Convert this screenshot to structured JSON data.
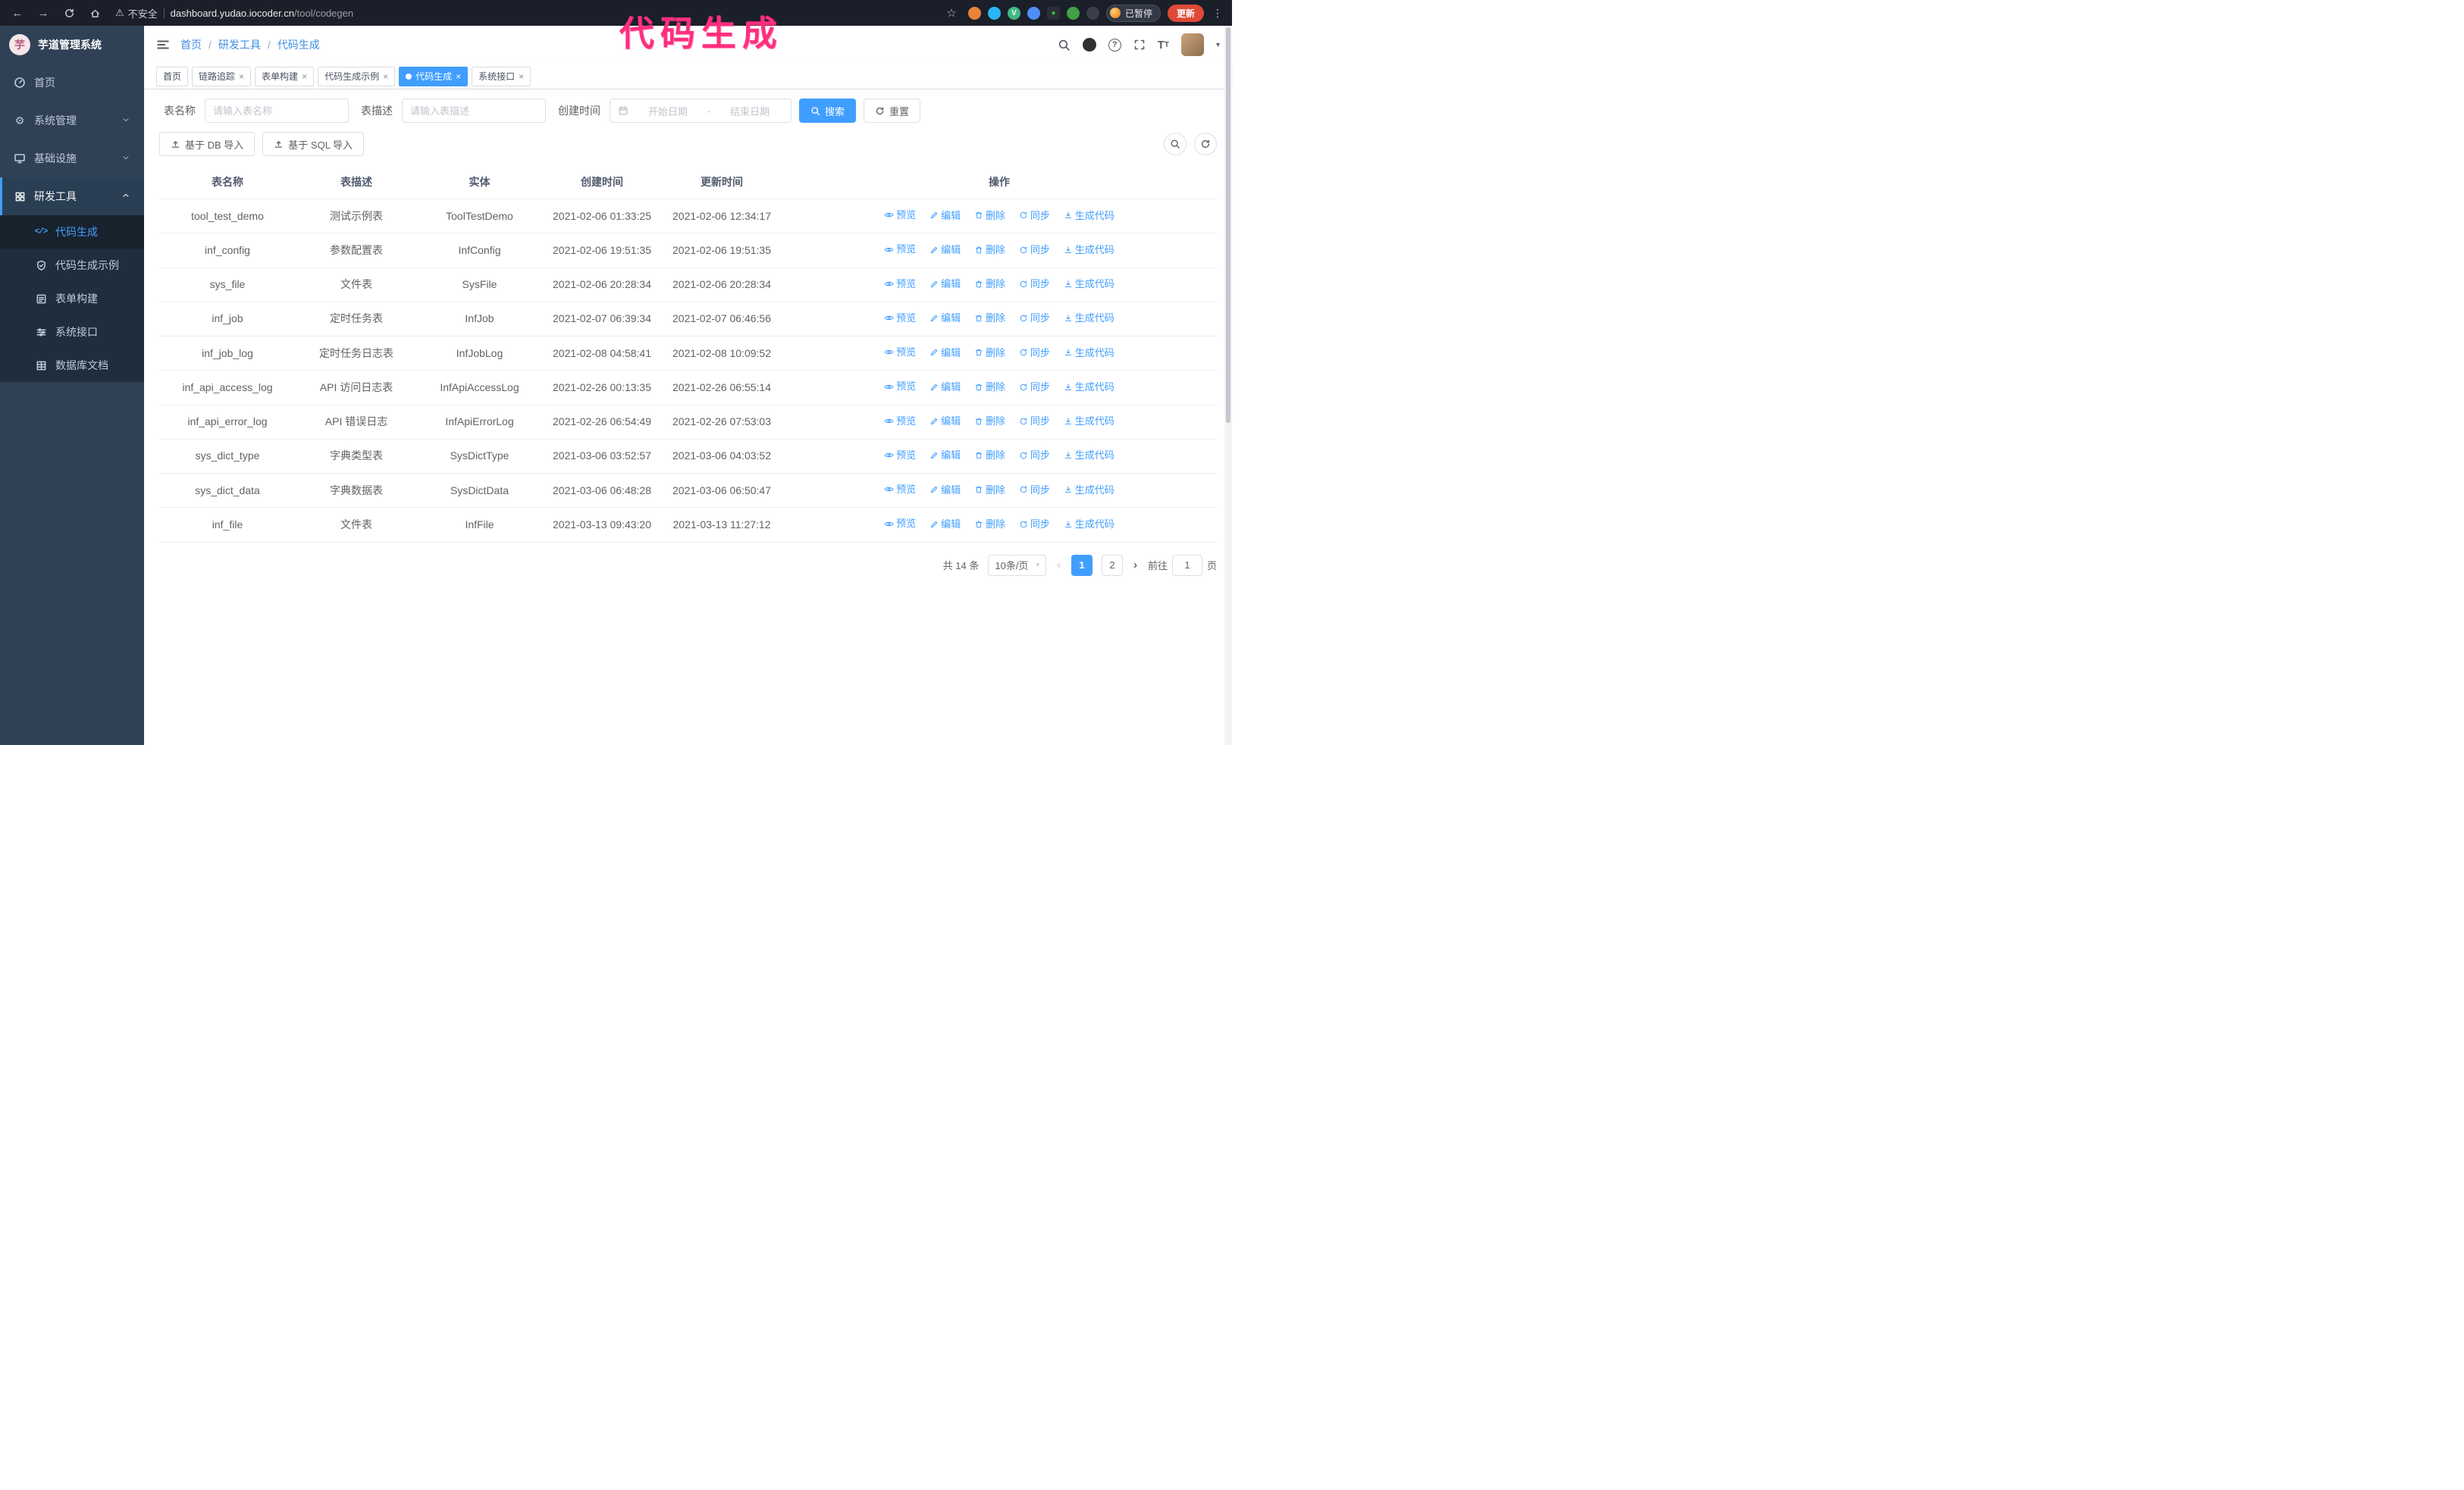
{
  "annotation": {
    "text": "代码生成",
    "color": "#ff2e7e"
  },
  "browser": {
    "security_label": "不安全",
    "url_host": "dashboard.yudao.iocoder.cn",
    "url_path": "/tool/codegen",
    "paused_badge": "已暂停",
    "update_button": "更新"
  },
  "sidebar": {
    "title": "芋道管理系统",
    "items": [
      {
        "label": "首页"
      },
      {
        "label": "系统管理"
      },
      {
        "label": "基础设施"
      },
      {
        "label": "研发工具"
      }
    ],
    "subitems": [
      {
        "label": "代码生成"
      },
      {
        "label": "代码生成示例"
      },
      {
        "label": "表单构建"
      },
      {
        "label": "系统接口"
      },
      {
        "label": "数据库文档"
      }
    ]
  },
  "breadcrumb": {
    "items": [
      {
        "label": "首页"
      },
      {
        "label": "研发工具"
      },
      {
        "label": "代码生成"
      }
    ]
  },
  "tabs": [
    {
      "label": "首页"
    },
    {
      "label": "链路追踪"
    },
    {
      "label": "表单构建"
    },
    {
      "label": "代码生成示例"
    },
    {
      "label": "代码生成"
    },
    {
      "label": "系统接口"
    }
  ],
  "filters": {
    "table_name_label": "表名称",
    "table_name_placeholder": "请输入表名称",
    "table_desc_label": "表描述",
    "table_desc_placeholder": "请输入表描述",
    "create_time_label": "创建时间",
    "date_start_placeholder": "开始日期",
    "date_separator": "-",
    "date_end_placeholder": "结束日期",
    "search_button": "搜索",
    "reset_button": "重置"
  },
  "toolbar": {
    "import_db": "基于 DB 导入",
    "import_sql": "基于 SQL 导入"
  },
  "table": {
    "columns": [
      "表名称",
      "表描述",
      "实体",
      "创建时间",
      "更新时间",
      "操作"
    ],
    "actions": [
      "预览",
      "编辑",
      "删除",
      "同步",
      "生成代码"
    ],
    "rows": [
      {
        "name": "tool_test_demo",
        "desc": "测试示例表",
        "entity": "ToolTestDemo",
        "created": "2021-02-06 01:33:25",
        "updated": "2021-02-06 12:34:17"
      },
      {
        "name": "inf_config",
        "desc": "参数配置表",
        "entity": "InfConfig",
        "created": "2021-02-06 19:51:35",
        "updated": "2021-02-06 19:51:35"
      },
      {
        "name": "sys_file",
        "desc": "文件表",
        "entity": "SysFile",
        "created": "2021-02-06 20:28:34",
        "updated": "2021-02-06 20:28:34"
      },
      {
        "name": "inf_job",
        "desc": "定时任务表",
        "entity": "InfJob",
        "created": "2021-02-07 06:39:34",
        "updated": "2021-02-07 06:46:56"
      },
      {
        "name": "inf_job_log",
        "desc": "定时任务日志表",
        "entity": "InfJobLog",
        "created": "2021-02-08 04:58:41",
        "updated": "2021-02-08 10:09:52"
      },
      {
        "name": "inf_api_access_log",
        "desc": "API 访问日志表",
        "entity": "InfApiAccessLog",
        "created": "2021-02-26 00:13:35",
        "updated": "2021-02-26 06:55:14"
      },
      {
        "name": "inf_api_error_log",
        "desc": "API 错误日志",
        "entity": "InfApiErrorLog",
        "created": "2021-02-26 06:54:49",
        "updated": "2021-02-26 07:53:03"
      },
      {
        "name": "sys_dict_type",
        "desc": "字典类型表",
        "entity": "SysDictType",
        "created": "2021-03-06 03:52:57",
        "updated": "2021-03-06 04:03:52"
      },
      {
        "name": "sys_dict_data",
        "desc": "字典数据表",
        "entity": "SysDictData",
        "created": "2021-03-06 06:48:28",
        "updated": "2021-03-06 06:50:47"
      },
      {
        "name": "inf_file",
        "desc": "文件表",
        "entity": "InfFile",
        "created": "2021-03-13 09:43:20",
        "updated": "2021-03-13 11:27:12"
      }
    ]
  },
  "pagination": {
    "total": "共 14 条",
    "page_size": "10条/页",
    "pages": [
      "1",
      "2"
    ],
    "goto_label": "前往",
    "goto_value": "1",
    "goto_suffix": "页"
  },
  "colors": {
    "accent": "#409eff",
    "sidebar_bg": "#304156",
    "submenu_bg": "#1f2d3d",
    "annotation": "#ff2e7e",
    "update_button": "#df4837"
  }
}
